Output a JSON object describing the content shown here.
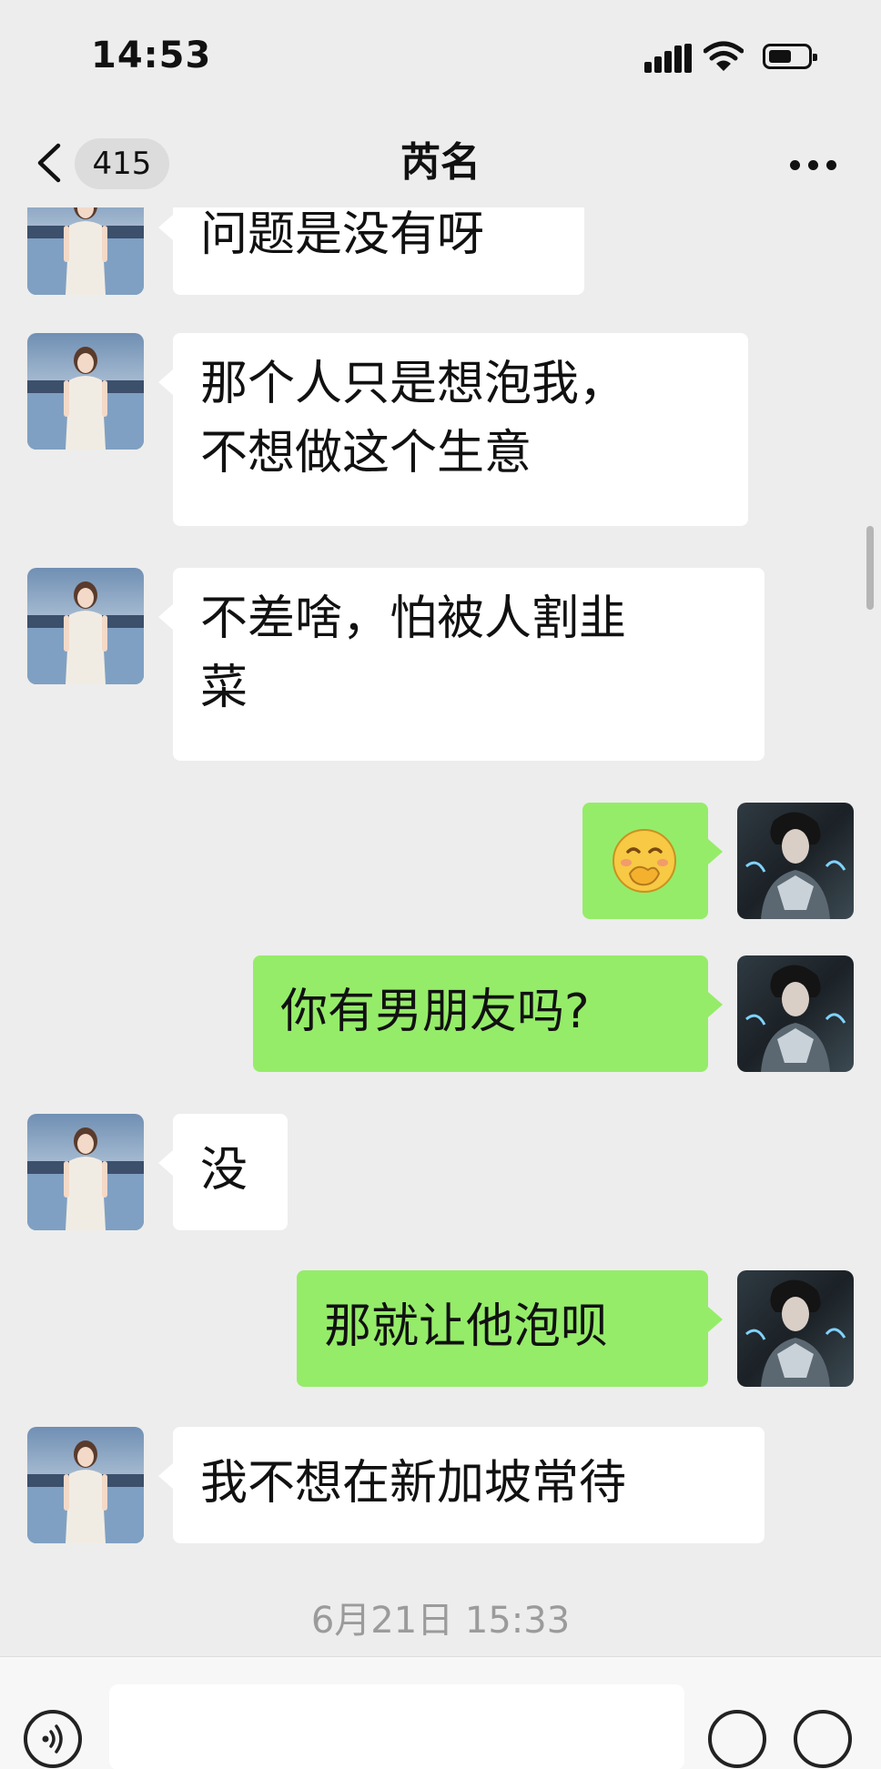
{
  "status_bar": {
    "time": "14:53",
    "icons": [
      "signal-icon",
      "wifi-icon",
      "battery-icon"
    ]
  },
  "nav": {
    "back_icon": "chevron-left-icon",
    "unread_count": "415",
    "title": "芮名",
    "more_icon": "more-dots-icon"
  },
  "messages": [
    {
      "side": "left",
      "text": "问题是没有呀"
    },
    {
      "side": "left",
      "text": "那个人只是想泡我，\n不想做这个生意"
    },
    {
      "side": "left",
      "text": "不差啥，怕被人割韭\n菜"
    },
    {
      "side": "right",
      "emoji": "covering-mouth-laugh-emoji"
    },
    {
      "side": "right",
      "text": "你有男朋友吗?"
    },
    {
      "side": "left",
      "text": "没"
    },
    {
      "side": "right",
      "text": "那就让他泡呗"
    },
    {
      "side": "left",
      "text": "我不想在新加坡常待"
    }
  ],
  "timestamp": "6月21日 15:33",
  "input_bar": {
    "icons": [
      "voice-icon",
      "emoji-icon",
      "plus-icon"
    ],
    "input_value": ""
  },
  "colors": {
    "background": "#ededed",
    "bubble_self": "#95ec69",
    "bubble_other": "#ffffff",
    "timestamp": "#9b9b9b"
  }
}
